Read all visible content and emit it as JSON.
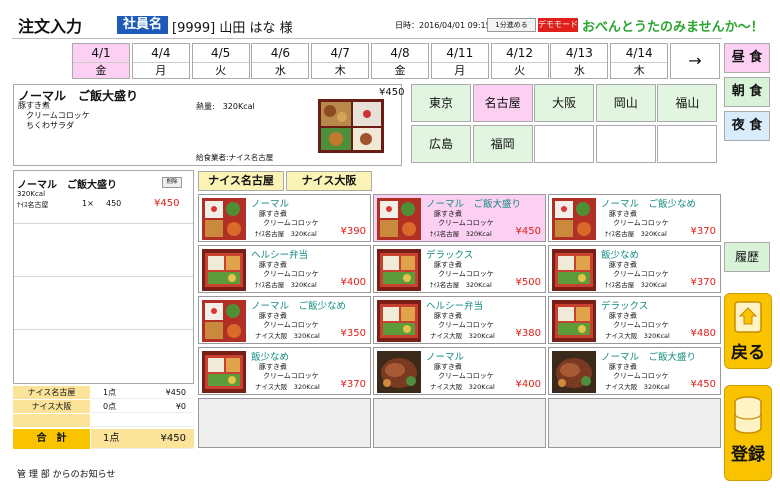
{
  "header": {
    "title": "注文入力",
    "employee_label": "社員名",
    "employee_info": "[9999] 山田 はな 様",
    "datetime": "日時：2016/04/01 09:15",
    "one_min_button": "1分進める",
    "demo_badge": "デモモード",
    "message": "おべんとうたのみませんか～！"
  },
  "dates": [
    {
      "date": "4/1",
      "weekday": "金"
    },
    {
      "date": "4/4",
      "weekday": "月"
    },
    {
      "date": "4/5",
      "weekday": "火"
    },
    {
      "date": "4/6",
      "weekday": "水"
    },
    {
      "date": "4/7",
      "weekday": "木"
    },
    {
      "date": "4/8",
      "weekday": "金"
    },
    {
      "date": "4/11",
      "weekday": "月"
    },
    {
      "date": "4/12",
      "weekday": "火"
    },
    {
      "date": "4/13",
      "weekday": "水"
    },
    {
      "date": "4/14",
      "weekday": "木"
    }
  ],
  "date_next_label": "→",
  "meals": {
    "lunch": "昼 食",
    "breakfast": "朝 食",
    "dinner": "夜 食"
  },
  "history_label": "履歴",
  "back_label": "戻る",
  "register_label": "登録",
  "detail": {
    "name": "ノーマル　ご飯大盛り",
    "items": [
      "豚すき煮",
      "クリームコロッケ",
      "ちくわサラダ"
    ],
    "calories": "熱量:　320Kcal",
    "price": "¥450",
    "supplier": "給食業者:ナイス名古屋"
  },
  "regions": [
    {
      "name": "東京",
      "state": "normal"
    },
    {
      "name": "名古屋",
      "state": "active"
    },
    {
      "name": "大阪",
      "state": "normal"
    },
    {
      "name": "岡山",
      "state": "normal"
    },
    {
      "name": "福山",
      "state": "normal"
    },
    {
      "name": "広島",
      "state": "normal"
    },
    {
      "name": "福岡",
      "state": "normal"
    },
    {
      "name": "",
      "state": "empty"
    },
    {
      "name": "",
      "state": "empty"
    },
    {
      "name": "",
      "state": "empty"
    }
  ],
  "order": {
    "name": "ノーマル　ご飯大盛り",
    "calories": "320Kcal",
    "supplier": "ﾅｲｽ名古屋",
    "qty": "1×",
    "unit_price": "450",
    "amount": "¥450",
    "delete_label": "削除"
  },
  "totals": [
    {
      "label": "ナイス名古屋",
      "count": "1点",
      "amount": "¥450"
    },
    {
      "label": "ナイス大阪",
      "count": "0点",
      "amount": "¥0"
    }
  ],
  "grand_total": {
    "label": "合　計",
    "count": "1点",
    "amount": "¥450"
  },
  "notice": "管 理 部 からのお知らせ",
  "supplier_tabs": [
    "ナイス名古屋",
    "ナイス大阪"
  ],
  "products": [
    {
      "name": "ノーマル",
      "item1": "豚すき煮",
      "item2": "クリームコロッケ",
      "supplier": "ﾅｲｽ名古屋　320Kcal",
      "price": "¥390",
      "selected": false,
      "photo": "bento"
    },
    {
      "name": "ノーマル　ご飯大盛り",
      "item1": "豚すき煮",
      "item2": "クリームコロッケ",
      "supplier": "ﾅｲｽ名古屋　320Kcal",
      "price": "¥450",
      "selected": true,
      "photo": "bento"
    },
    {
      "name": "ノーマル　ご飯少なめ",
      "item1": "豚すき煮",
      "item2": "クリームコロッケ",
      "supplier": "ﾅｲｽ名古屋　320Kcal",
      "price": "¥370",
      "selected": false,
      "photo": "bento"
    },
    {
      "name": "ヘルシー弁当",
      "item1": "豚すき煮",
      "item2": "クリームコロッケ",
      "supplier": "ﾅｲｽ名古屋　320Kcal",
      "price": "¥400",
      "selected": false,
      "photo": "box"
    },
    {
      "name": "デラックス",
      "item1": "豚すき煮",
      "item2": "クリームコロッケ",
      "supplier": "ﾅｲｽ名古屋　320Kcal",
      "price": "¥500",
      "selected": false,
      "photo": "box"
    },
    {
      "name": "飯少なめ",
      "item1": "豚すき煮",
      "item2": "クリームコロッケ",
      "supplier": "ﾅｲｽ名古屋　320Kcal",
      "price": "¥370",
      "selected": false,
      "photo": "box"
    },
    {
      "name": "ノーマル　ご飯少なめ",
      "item1": "豚すき煮",
      "item2": "クリームコロッケ",
      "supplier": "ナイス大阪　320Kcal",
      "price": "¥350",
      "selected": false,
      "photo": "bento"
    },
    {
      "name": "ヘルシー弁当",
      "item1": "豚すき煮",
      "item2": "クリームコロッケ",
      "supplier": "ナイス大阪　320Kcal",
      "price": "¥380",
      "selected": false,
      "photo": "box"
    },
    {
      "name": "デラックス",
      "item1": "豚すき煮",
      "item2": "クリームコロッケ",
      "supplier": "ナイス大阪　320Kcal",
      "price": "¥480",
      "selected": false,
      "photo": "box"
    },
    {
      "name": "飯少なめ",
      "item1": "豚すき煮",
      "item2": "クリームコロッケ",
      "supplier": "ナイス大阪　320Kcal",
      "price": "¥370",
      "selected": false,
      "photo": "box"
    },
    {
      "name": "ノーマル",
      "item1": "豚すき煮",
      "item2": "クリームコロッケ",
      "supplier": "ナイス大阪　320Kcal",
      "price": "¥400",
      "selected": false,
      "photo": "steak"
    },
    {
      "name": "ノーマル　ご飯大盛り",
      "item1": "豚すき煮",
      "item2": "クリームコロッケ",
      "supplier": "ナイス大阪　320Kcal",
      "price": "¥450",
      "selected": false,
      "photo": "steak"
    }
  ]
}
